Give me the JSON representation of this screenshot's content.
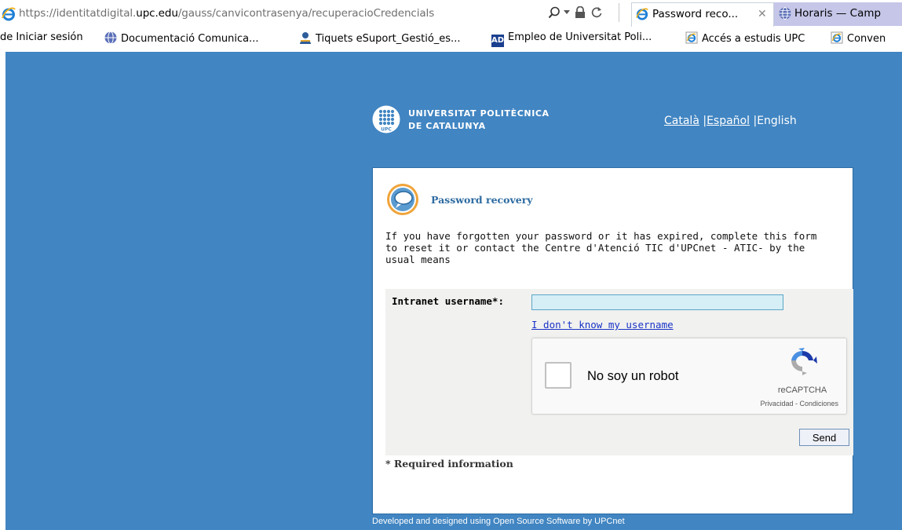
{
  "browser": {
    "url_prefix": "https://",
    "url_domain_pre": "identitatdigital.",
    "url_domain_main": "upc.edu",
    "url_path": "/gauss/canvicontrasenya/recuperacioCredencials",
    "tabs": [
      {
        "label": "Password reco...",
        "close": "✕"
      },
      {
        "label": "Horaris — Camp"
      }
    ]
  },
  "favorites": [
    {
      "label": "de Iniciar sesión",
      "icon": "none"
    },
    {
      "label": "Documentació Comunica...",
      "icon": "globe-icon"
    },
    {
      "label": "Tiquets eSuport_Gestió_es...",
      "icon": "person-icon"
    },
    {
      "label": "Empleo de Universitat Poli...",
      "icon": "ad-icon",
      "icon_text": "AD"
    },
    {
      "label": "Accés a estudis UPC",
      "icon": "ie-page-icon"
    },
    {
      "label": "Conven",
      "icon": "ie-page-icon"
    }
  ],
  "header": {
    "brand_line1": "UNIVERSITAT POLITÈCNICA",
    "brand_line2": "DE CATALUNYA",
    "brand_logo_text": "UPC",
    "lang_catala": "Català",
    "lang_sep1": " |",
    "lang_espanol": "Español",
    "lang_sep2": " |",
    "lang_english": "English"
  },
  "card": {
    "title": "Password recovery",
    "intro": "If you have forgotten your password or it has expired, complete this form to reset it or contact the Centre d'Atenció TIC d'UPCnet - ATIC- by the usual means",
    "username_label": "Intranet username*:",
    "username_value": "",
    "forgot_link": "I don't know my username",
    "recaptcha_label": "No soy un robot",
    "recaptcha_brand": "reCAPTCHA",
    "recaptcha_terms": "Privacidad - Condiciones",
    "send_label": "Send",
    "required_note": "* Required information"
  },
  "footer": "Developed and designed using Open Source Software by UPCnet",
  "colors": {
    "page_bg": "#4185c2",
    "title": "#2c6aa0",
    "link": "#1a34c8",
    "input_bg": "#d6eef5"
  }
}
